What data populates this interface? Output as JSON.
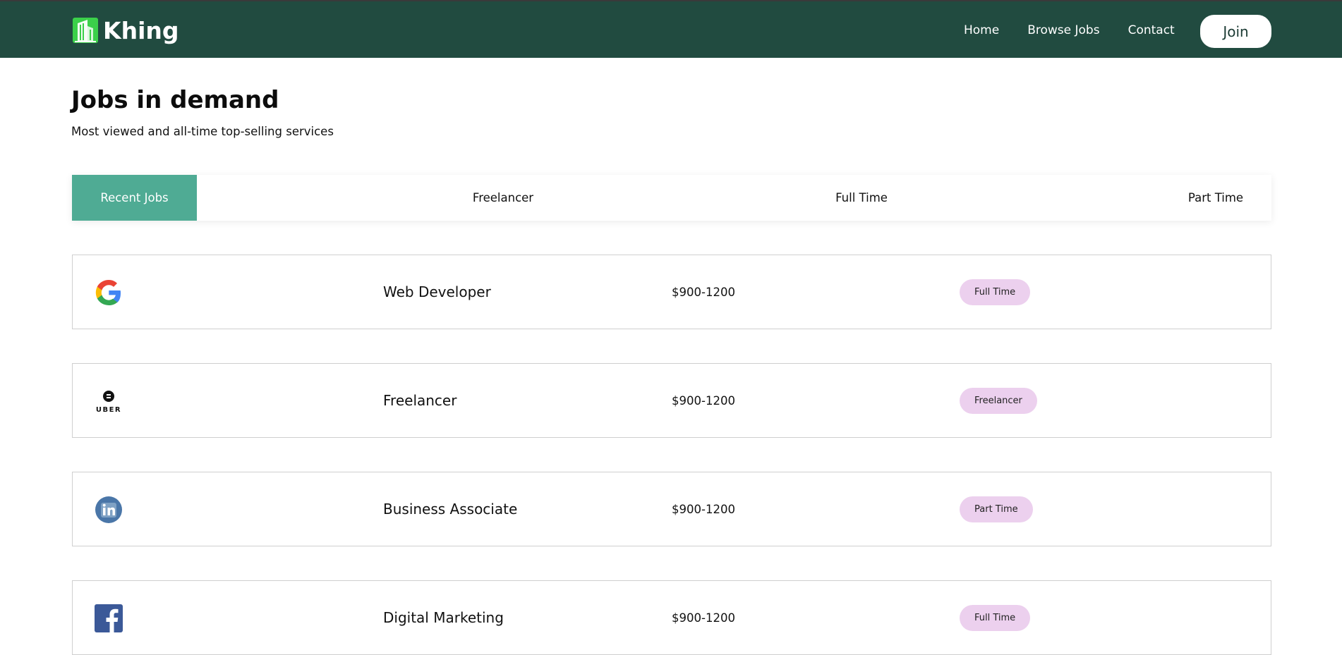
{
  "header": {
    "brand": "Khing",
    "nav": [
      "Home",
      "Browse Jobs",
      "Contact"
    ],
    "join_label": "Join",
    "bg_color": "#214b40"
  },
  "main": {
    "title": "Jobs in demand",
    "subtitle": "Most viewed and all-time top-selling services",
    "tabs": [
      {
        "label": "Recent Jobs",
        "active": true
      },
      {
        "label": "Freelancer",
        "active": false
      },
      {
        "label": "Full Time",
        "active": false
      },
      {
        "label": "Part Time",
        "active": false
      }
    ],
    "active_tab_color": "#4fab94",
    "jobs": [
      {
        "company_icon": "google-logo-icon",
        "title": "Web Developer",
        "salary": "$900-1200",
        "type": "Full Time"
      },
      {
        "company_icon": "uber-logo-icon",
        "title": "Freelancer",
        "salary": "$900-1200",
        "type": "Freelancer"
      },
      {
        "company_icon": "linkedin-logo-icon",
        "title": "Business Associate",
        "salary": "$900-1200",
        "type": "Part Time"
      },
      {
        "company_icon": "facebook-logo-icon",
        "title": "Digital Marketing",
        "salary": "$900-1200",
        "type": "Full Time"
      }
    ],
    "badge_color": "#ecd0ee"
  }
}
